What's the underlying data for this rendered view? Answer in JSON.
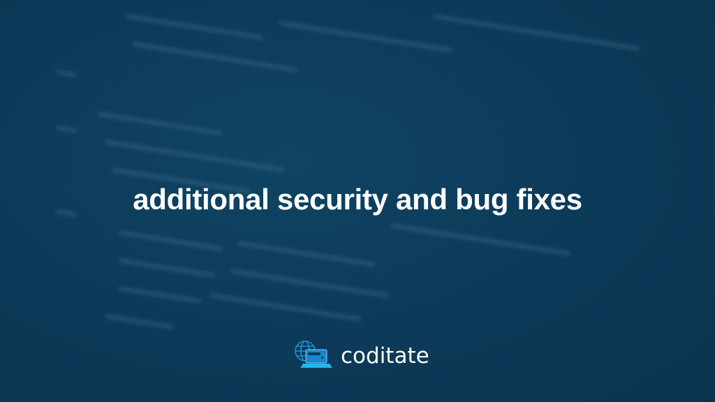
{
  "slide": {
    "title": "additional security and bug fixes"
  },
  "logo": {
    "name": "coditate",
    "icon": "globe-laptop-icon"
  }
}
